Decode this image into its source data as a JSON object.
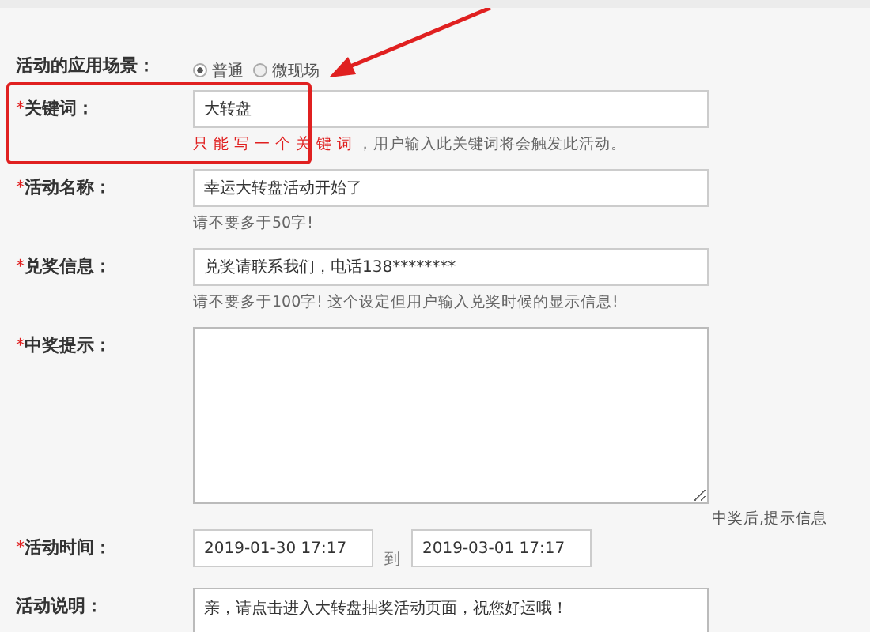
{
  "form": [
    {
      "kind": "radio",
      "label": "活动的应用场景：",
      "options": [
        {
          "label": "普通",
          "selected": true
        },
        {
          "label": "微现场",
          "selected": false
        }
      ]
    },
    {
      "kind": "input",
      "mark": "*",
      "label": "关键词：",
      "value": "大转盘",
      "warning": "只能写一个关键词",
      "hint": "，用户输入此关键词将会触发此活动。"
    },
    {
      "kind": "input",
      "mark": "*",
      "label": "活动名称：",
      "value": "幸运大转盘活动开始了",
      "hint": "请不要多于50字!"
    },
    {
      "kind": "input",
      "mark": "*",
      "label": "兑奖信息：",
      "value": "兑奖请联系我们，电话138********",
      "hint": "请不要多于100字! 这个设定但用户输入兑奖时候的显示信息!"
    },
    {
      "kind": "textarea",
      "mark": "*",
      "label": "中奖提示：",
      "side_note": "中奖后,提示信息"
    },
    {
      "kind": "daterange",
      "mark": "*",
      "label": "活动时间：",
      "start": "2019-01-30 17:17",
      "separator": "到",
      "end": "2019-03-01 17:17"
    },
    {
      "kind": "textarea_cut",
      "label": "活动说明：",
      "value": "亲，请点击进入大转盘抽奖活动页面，祝您好运哦！"
    }
  ],
  "annotation": {
    "color": "#e02020"
  }
}
